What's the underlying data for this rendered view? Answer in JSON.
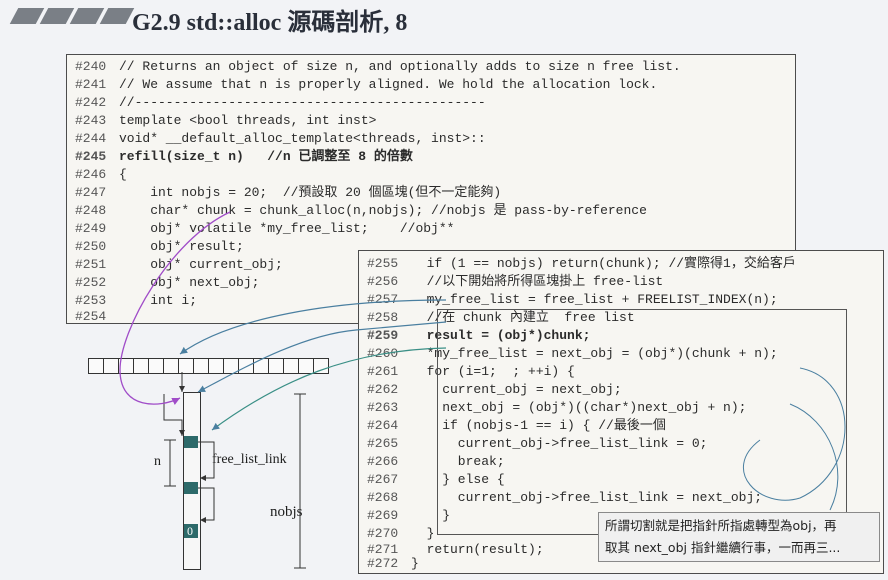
{
  "slide": {
    "title": "G2.9 std::alloc 源碼剖析, 8"
  },
  "left_code": [
    {
      "num": "#240",
      "text": "// Returns an object of size n, and optionally adds to size n free list."
    },
    {
      "num": "#241",
      "text": "// We assume that n is properly aligned. We hold the allocation lock."
    },
    {
      "num": "#242",
      "text": "//---------------------------------------------"
    },
    {
      "num": "#243",
      "text": "template <bool threads, int inst>"
    },
    {
      "num": "#244",
      "text": "void* __default_alloc_template<threads, inst>::"
    },
    {
      "num": "#245",
      "text": "refill(size_t n)   //n 已調整至 8 的倍數"
    },
    {
      "num": "#246",
      "text": "{"
    },
    {
      "num": "#247",
      "text": "    int nobjs = 20;  //預設取 20 個區塊(但不一定能夠)"
    },
    {
      "num": "#248",
      "text": "    char* chunk = chunk_alloc(n,nobjs); //nobjs 是 pass-by-reference"
    },
    {
      "num": "#249",
      "text": "    obj* volatile *my_free_list;    //obj**"
    },
    {
      "num": "#250",
      "text": "    obj* result;"
    },
    {
      "num": "#251",
      "text": "    obj* current_obj;"
    },
    {
      "num": "#252",
      "text": "    obj* next_obj;"
    },
    {
      "num": "#253",
      "text": "    int i;"
    },
    {
      "num": "#254",
      "text": ""
    }
  ],
  "right_code": [
    {
      "num": "#255",
      "text": "  if (1 == nobjs) return(chunk); //實際得1，交給客戶"
    },
    {
      "num": "#256",
      "text": "  //以下開始將所得區塊掛上 free-list"
    },
    {
      "num": "#257",
      "text": "  my_free_list = free_list + FREELIST_INDEX(n);"
    },
    {
      "num": "#258",
      "text": "  //在 chunk 內建立  free list"
    },
    {
      "num": "#259",
      "text": "  result = (obj*)chunk;"
    },
    {
      "num": "#260",
      "text": "  *my_free_list = next_obj = (obj*)(chunk + n);"
    },
    {
      "num": "#261",
      "text": "  for (i=1;  ; ++i) {"
    },
    {
      "num": "#262",
      "text": "    current_obj = next_obj;"
    },
    {
      "num": "#263",
      "text": "    next_obj = (obj*)((char*)next_obj + n);"
    },
    {
      "num": "#264",
      "text": "    if (nobjs-1 == i) { //最後一個"
    },
    {
      "num": "#265",
      "text": "      current_obj->free_list_link = 0;"
    },
    {
      "num": "#266",
      "text": "      break;"
    },
    {
      "num": "#267",
      "text": "    } else {"
    },
    {
      "num": "#268",
      "text": "      current_obj->free_list_link = next_obj;"
    },
    {
      "num": "#269",
      "text": "    }"
    },
    {
      "num": "#270",
      "text": "  }"
    },
    {
      "num": "#271",
      "text": "  return(result);"
    },
    {
      "num": "#272",
      "text": "}"
    }
  ],
  "diagram": {
    "n_label": "n",
    "free_list_link_label": "free_list_link",
    "nobjs_label": "nobjs",
    "zero_label": "0"
  },
  "note": {
    "line1": "所謂切割就是把指針所指處轉型為obj，再",
    "line2": "取其 next_obj 指針繼續行事，一而再三..."
  },
  "colors": {
    "accent_magenta": "#b0187a",
    "teal": "#2d6a6a",
    "arrow_blue": "#4a7fa0",
    "arrow_purple": "#a04cc8"
  }
}
